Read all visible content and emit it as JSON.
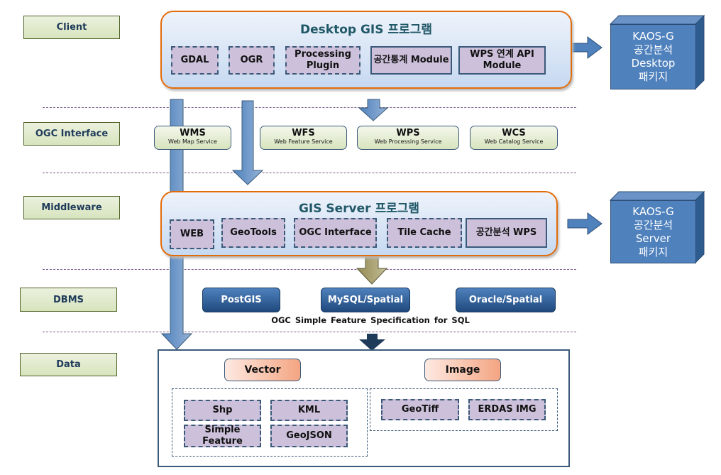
{
  "layers": [
    "Client",
    "OGC Interface",
    "Middleware",
    "DBMS",
    "Data"
  ],
  "desktop": {
    "title": "Desktop GIS 프로그램",
    "modules": [
      "GDAL",
      "OGR",
      "Processing Plugin",
      "공간통계 Module",
      "WPS 연계 API Module"
    ]
  },
  "ogc_services": [
    {
      "name": "WMS",
      "desc": "Web Map Service"
    },
    {
      "name": "WFS",
      "desc": "Web Feature Service"
    },
    {
      "name": "WPS",
      "desc": "Web Processing Service"
    },
    {
      "name": "WCS",
      "desc": "Web Catalog Service"
    }
  ],
  "server": {
    "title": "GIS Server 프로그램",
    "modules": [
      "WEB",
      "GeoTools",
      "OGC Interface",
      "Tile Cache",
      "공간분석 WPS"
    ]
  },
  "dbms": {
    "items": [
      "PostGIS",
      "MySQL/Spatial",
      "Oracle/Spatial"
    ],
    "spec": "OGC Simple Feature Specification for SQL"
  },
  "data": {
    "vector": {
      "label": "Vector",
      "items": [
        "Shp",
        "KML",
        "Simple Feature",
        "GeoJSON"
      ]
    },
    "image": {
      "label": "Image",
      "items": [
        "GeoTiff",
        "ERDAS IMG"
      ]
    }
  },
  "packages": {
    "desktop": [
      "KAOS-G",
      "공간분석",
      "Desktop",
      "패키지"
    ],
    "server": [
      "KAOS-G",
      "공간분석",
      "Server",
      "패키지"
    ]
  },
  "colors": {
    "accent_border": "#e36c0a",
    "layer_fill": "#d7e4bd",
    "module_fill": "#ccc0da",
    "db_fill": "#1f497d",
    "package_fill": "#4f81bd"
  }
}
